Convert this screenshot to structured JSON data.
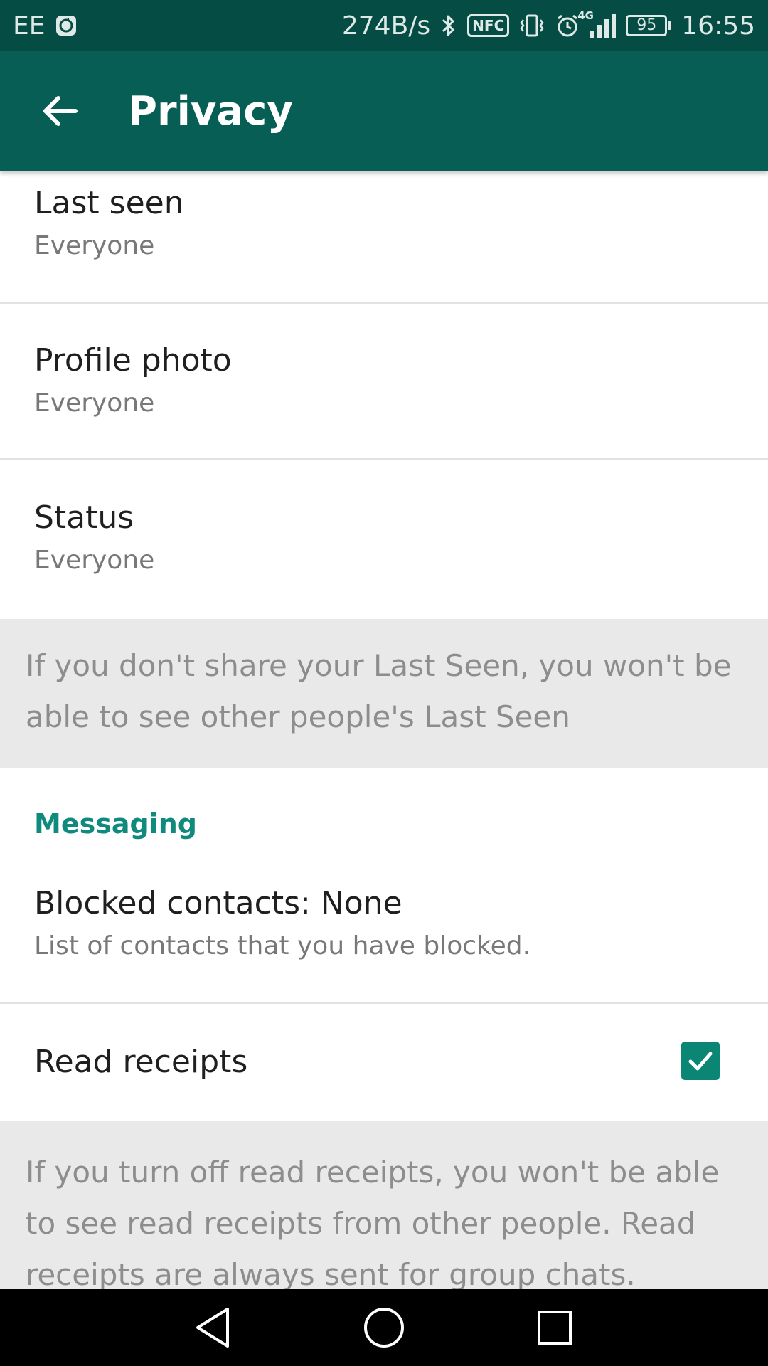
{
  "status_bar": {
    "carrier": "EE",
    "net_speed": "274B/s",
    "nfc_label": "NFC",
    "network_type": "4G",
    "battery": "95",
    "time": "16:55"
  },
  "app_bar": {
    "title": "Privacy"
  },
  "privacy_items": [
    {
      "title": "Last seen",
      "subtitle": "Everyone"
    },
    {
      "title": "Profile photo",
      "subtitle": "Everyone"
    },
    {
      "title": "Status",
      "subtitle": "Everyone"
    }
  ],
  "last_seen_note": "If you don't share your Last Seen, you won't be able to see other people's Last Seen",
  "messaging": {
    "header": "Messaging",
    "blocked": {
      "title": "Blocked contacts: None",
      "subtitle": "List of contacts that you have blocked."
    },
    "read_receipts": {
      "title": "Read receipts",
      "checked": true
    },
    "read_receipts_note": "If you turn off read receipts, you won't be able to see read receipts from other people. Read receipts are always sent for group chats."
  },
  "colors": {
    "app_bar": "#075e54",
    "status_bar": "#054d44",
    "accent": "#0f8a7c",
    "checkbox": "#0b8574"
  },
  "icons": {
    "back": "arrow-left-icon",
    "bluetooth": "bluetooth-icon",
    "vibrate": "vibrate-icon",
    "alarm": "alarm-icon",
    "signal": "signal-icon",
    "battery": "battery-icon",
    "nav_back": "nav-back-icon",
    "nav_home": "nav-home-icon",
    "nav_recents": "nav-recents-icon"
  }
}
